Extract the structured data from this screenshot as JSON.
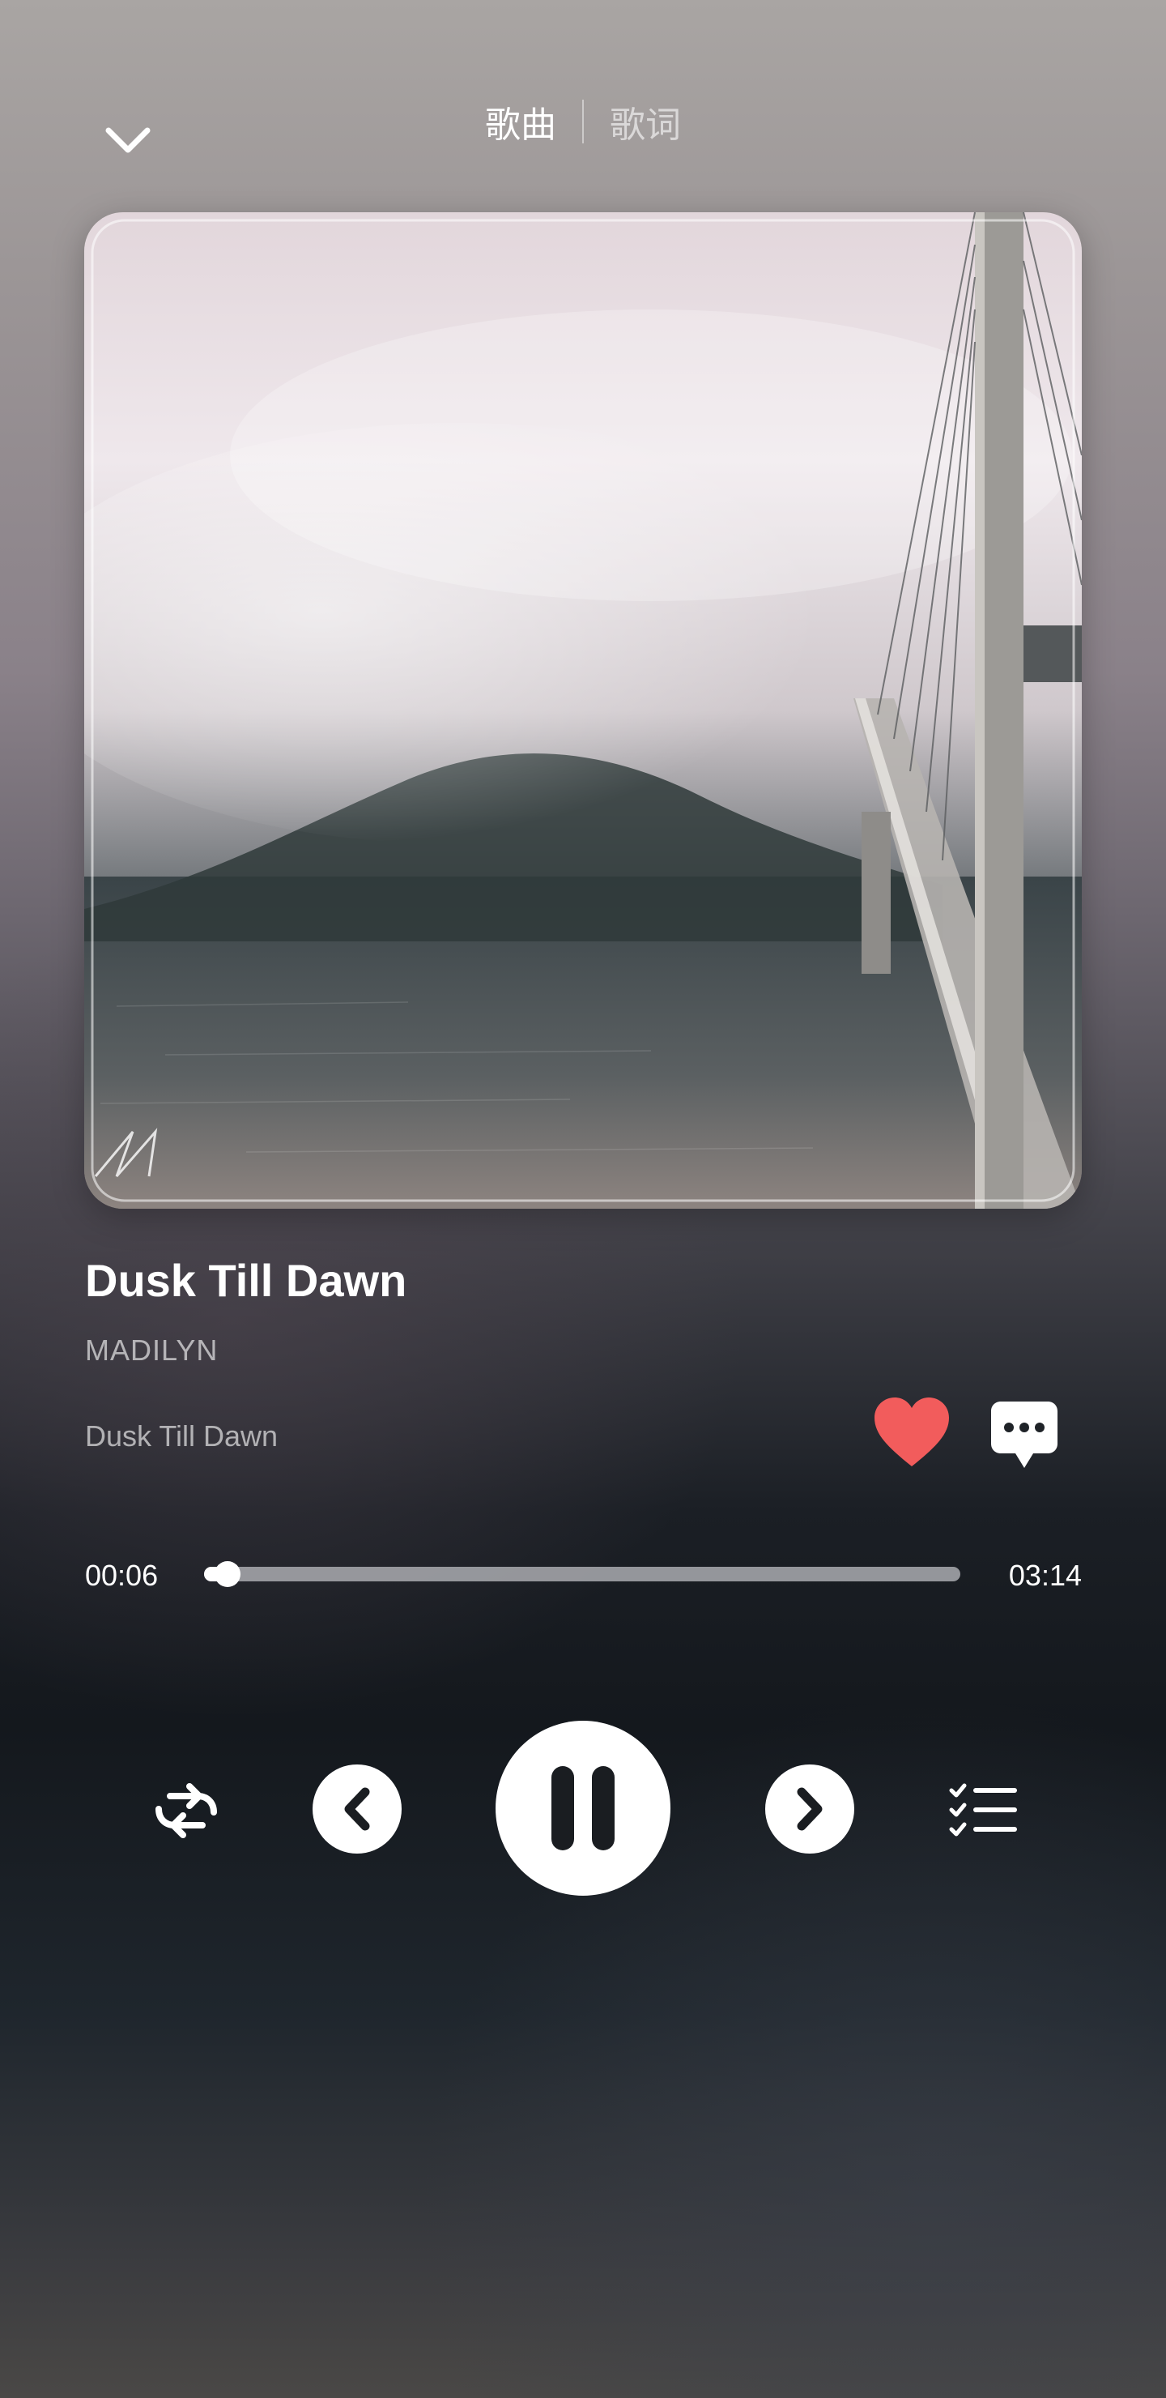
{
  "header": {
    "back_icon": "chevron-down-icon",
    "tabs": [
      {
        "label": "歌曲",
        "active": true
      },
      {
        "label": "歌词",
        "active": false
      }
    ]
  },
  "cover": {
    "description_icon": "album-cover-image"
  },
  "song": {
    "title": "Dusk Till Dawn",
    "artist": "MADILYN",
    "album": "Dusk Till Dawn",
    "liked": true
  },
  "progress": {
    "current": "00:06",
    "total": "03:14",
    "fraction": 0.031
  },
  "controls": {
    "repeat_icon": "repeat-icon",
    "prev_icon": "previous-icon",
    "play_state_icon": "pause-icon",
    "next_icon": "next-icon",
    "playlist_icon": "playlist-icon",
    "like_icon": "heart-icon",
    "comment_icon": "comment-icon"
  },
  "colors": {
    "heart": "#f25c5c",
    "primary_text": "#ffffff"
  }
}
